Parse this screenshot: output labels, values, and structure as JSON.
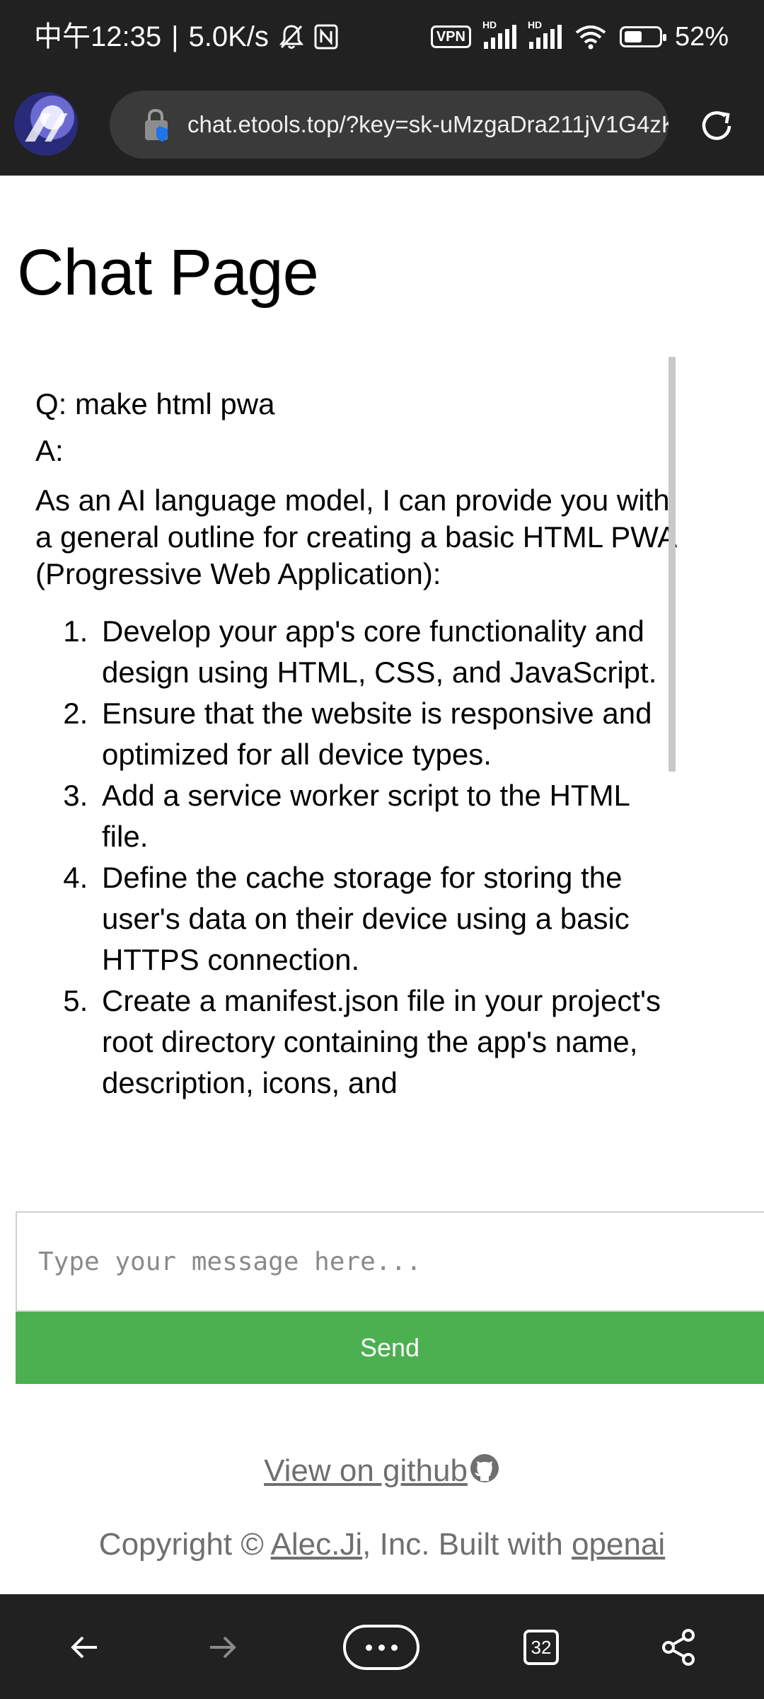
{
  "status_bar": {
    "time": "中午12:35",
    "net_speed": "5.0K/s",
    "vpn": "VPN",
    "hd1": "HD",
    "hd2": "HD",
    "battery": "52%"
  },
  "browser": {
    "url": "chat.etools.top/?key=sk-uMzgaDra211jV1G4zK",
    "tab_count": "32"
  },
  "page": {
    "title": "Chat Page",
    "question": "Q: make html pwa",
    "answer_label": "A:",
    "answer_intro": "As an AI language model, I can provide you with a general outline for creating a basic HTML PWA (Progressive Web Application):",
    "steps": [
      "Develop your app's core functionality and design using HTML, CSS, and JavaScript.",
      "Ensure that the website is responsive and optimized for all device types.",
      "Add a service worker script to the HTML file.",
      "Define the cache storage for storing the user's data on their device using a basic HTTPS connection.",
      "Create a manifest.json file in your project's root directory containing the app's name, description, icons, and"
    ],
    "input_placeholder": "Type your message here...",
    "send_label": "Send",
    "github_link": "View on github",
    "copyright_prefix": "Copyright © ",
    "copyright_author": "Alec.Ji",
    "copyright_middle": ", Inc. Built with ",
    "copyright_tool": "openai"
  }
}
